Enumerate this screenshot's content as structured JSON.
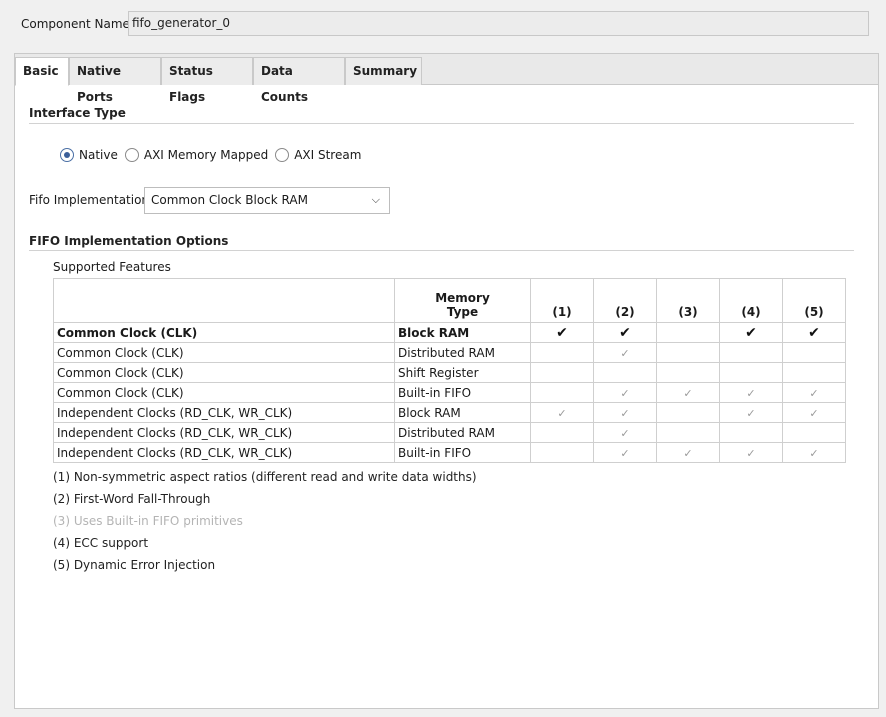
{
  "component": {
    "label": "Component Name",
    "value": "fifo_generator_0"
  },
  "tabs": [
    {
      "label": "Basic"
    },
    {
      "label": "Native Ports"
    },
    {
      "label": "Status Flags"
    },
    {
      "label": "Data Counts"
    },
    {
      "label": "Summary"
    }
  ],
  "interface": {
    "title": "Interface Type",
    "options": [
      "Native",
      "AXI Memory Mapped",
      "AXI Stream"
    ],
    "selected": "Native"
  },
  "fifo_impl": {
    "label": "Fifo Implementation",
    "value": "Common Clock Block RAM"
  },
  "options": {
    "title": "FIFO Implementation Options",
    "subtitle": "Supported Features",
    "col_memory_line1": "Memory",
    "col_memory_line2": "Type",
    "cols": [
      "(1)",
      "(2)",
      "(3)",
      "(4)",
      "(5)"
    ],
    "rows": [
      {
        "clock": "Common Clock (CLK)",
        "memory": "Block RAM",
        "selected": true,
        "checks": [
          1,
          1,
          0,
          1,
          1
        ]
      },
      {
        "clock": "Common Clock (CLK)",
        "memory": "Distributed RAM",
        "selected": false,
        "checks": [
          0,
          1,
          0,
          0,
          0
        ]
      },
      {
        "clock": "Common Clock (CLK)",
        "memory": "Shift Register",
        "selected": false,
        "checks": [
          0,
          0,
          0,
          0,
          0
        ]
      },
      {
        "clock": "Common Clock (CLK)",
        "memory": "Built-in FIFO",
        "selected": false,
        "checks": [
          0,
          1,
          1,
          1,
          1
        ]
      },
      {
        "clock": "Independent Clocks (RD_CLK, WR_CLK)",
        "memory": "Block RAM",
        "selected": false,
        "checks": [
          1,
          1,
          0,
          1,
          1
        ]
      },
      {
        "clock": "Independent Clocks (RD_CLK, WR_CLK)",
        "memory": "Distributed RAM",
        "selected": false,
        "checks": [
          0,
          1,
          0,
          0,
          0
        ]
      },
      {
        "clock": "Independent Clocks (RD_CLK, WR_CLK)",
        "memory": "Built-in FIFO",
        "selected": false,
        "checks": [
          0,
          1,
          1,
          1,
          1
        ]
      }
    ],
    "notes": [
      {
        "text": "(1) Non-symmetric aspect ratios (different read and write data widths)",
        "dim": false
      },
      {
        "text": "(2) First-Word Fall-Through",
        "dim": false
      },
      {
        "text": "(3) Uses Built-in FIFO primitives",
        "dim": true
      },
      {
        "text": "(4) ECC support",
        "dim": false
      },
      {
        "text": "(5) Dynamic Error Injection",
        "dim": false
      }
    ],
    "tick_glyph": "✓",
    "tick_glyph_bold": "✔"
  }
}
